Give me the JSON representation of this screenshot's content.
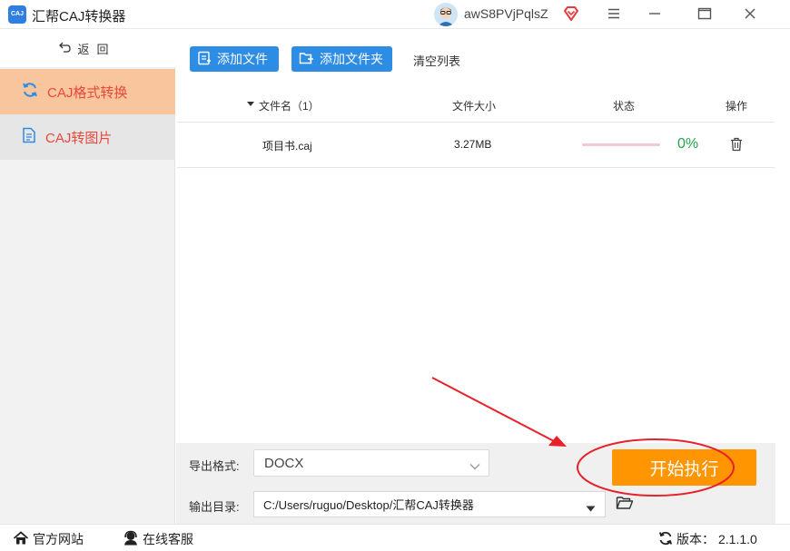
{
  "app": {
    "title": "汇帮CAJ转换器",
    "logo_text": "CAJ",
    "username": "awS8PVjPqlsZ",
    "brand_color": "#2d8ce4",
    "accent_color": "#ff9500"
  },
  "window_controls": {
    "menu_icon": "hamburger-icon",
    "minimize_icon": "minimize-icon",
    "maximize_icon": "maximize-icon",
    "close_icon": "close-icon"
  },
  "sidebar": {
    "back_label": "返回",
    "items": [
      {
        "label": "CAJ格式转换",
        "icon": "refresh-icon",
        "active": true
      },
      {
        "label": "CAJ转图片",
        "icon": "document-icon",
        "active": false
      }
    ]
  },
  "toolbar": {
    "add_file_label": "添加文件",
    "add_folder_label": "添加文件夹",
    "clear_list_label": "清空列表"
  },
  "table": {
    "headers": {
      "filename": "文件名（1）",
      "size": "文件大小",
      "status": "状态",
      "action": "操作"
    },
    "rows": [
      {
        "filename": "项目书.caj",
        "size": "3.27MB",
        "progress_text": "0%",
        "progress": 0
      }
    ]
  },
  "output": {
    "format_label": "导出格式:",
    "format_value": "DOCX",
    "dir_label": "输出目录:",
    "dir_value": "C:/Users/ruguo/Desktop/汇帮CAJ转换器",
    "start_label": "开始执行"
  },
  "statusbar": {
    "website_label": "官方网站",
    "support_label": "在线客服",
    "version_label": "版本：",
    "version_value": "2.1.1.0"
  }
}
